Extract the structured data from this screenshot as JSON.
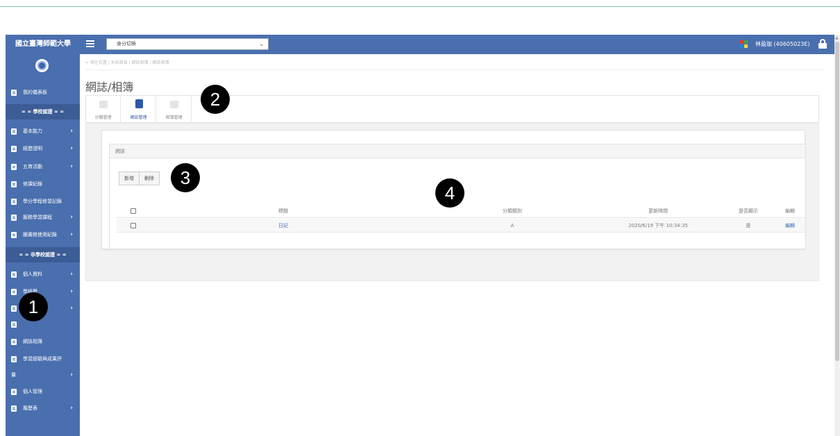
{
  "app": {
    "brand": "國立臺灣師範大學",
    "role_select": {
      "value": "身分切換"
    },
    "user": "林盈珈 (40605023E)"
  },
  "colors": {
    "primary": "#4a6fae",
    "primary_dark": "#3c5c96",
    "link": "#3a66b5"
  },
  "sidebar": {
    "dashboard": "我的儀表板",
    "section_school": "= = 學校認證 = =",
    "school_items": [
      {
        "label": "基本能力",
        "arrow": true
      },
      {
        "label": "經歷證明",
        "arrow": true
      },
      {
        "label": "五育活動",
        "arrow": true
      },
      {
        "label": "修課紀錄",
        "arrow": false
      },
      {
        "label": "學分學程修習記錄",
        "arrow": false
      },
      {
        "label": "服務學習課程",
        "arrow": true
      },
      {
        "label": "圖書館使用紀錄",
        "arrow": true
      }
    ],
    "section_nonschool": "= = 非學校認證 = =",
    "nonschool_items": [
      {
        "label": "個人資料",
        "arrow": true
      },
      {
        "label": "學經歷",
        "arrow": true
      },
      {
        "label": "",
        "arrow": true
      },
      {
        "label": "",
        "arrow": false
      },
      {
        "label": "網誌相簿",
        "arrow": false
      },
      {
        "label": "學習經驗與成果評",
        "arrow": false
      },
      {
        "label": "量",
        "arrow": true
      },
      {
        "label": "個人管理",
        "arrow": false
      },
      {
        "label": "履歷表",
        "arrow": true
      }
    ]
  },
  "breadcrumb": {
    "prefix": "= 現在位置",
    "items": [
      "系統首頁",
      "網誌相簿",
      "網誌相簿"
    ]
  },
  "page": {
    "title": "網誌/相簿",
    "tabs": [
      {
        "label": "分類管理",
        "icon": "folder-icon"
      },
      {
        "label": "網誌管理",
        "icon": "book-icon"
      },
      {
        "label": "相簿管理",
        "icon": "camera-icon"
      }
    ],
    "active_tab": "網誌管理"
  },
  "blog_panel": {
    "title": "網誌",
    "buttons": {
      "add": "新增",
      "delete": "刪除"
    },
    "columns": [
      "標題",
      "分類類別",
      "更新時間",
      "是否顯示",
      "編輯"
    ],
    "rows": [
      {
        "title": "日記",
        "category": "A",
        "updated": "2020/6/19 下午 10:34:35",
        "visible": "是",
        "edit": "編輯"
      }
    ]
  },
  "badges": [
    "1",
    "2",
    "3",
    "4"
  ]
}
